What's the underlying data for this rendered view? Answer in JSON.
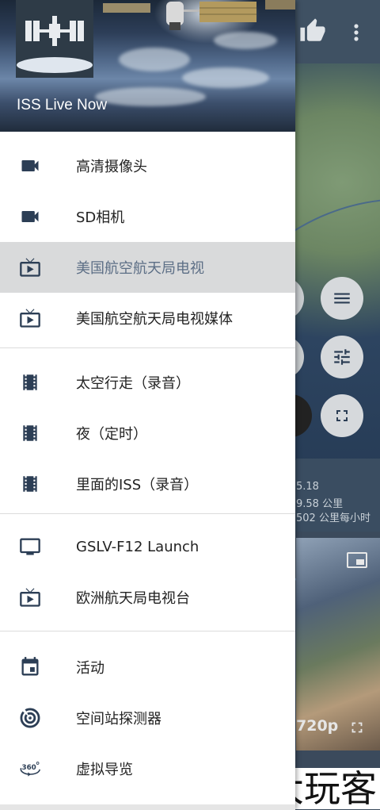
{
  "drawer": {
    "title": "ISS Live Now",
    "groups": [
      {
        "items": [
          {
            "icon": "video-camera-icon",
            "label": "高清摄像头",
            "selected": false
          },
          {
            "icon": "video-camera-icon",
            "label": "SD相机",
            "selected": false
          },
          {
            "icon": "live-tv-icon",
            "label": "美国航空航天局电视",
            "selected": true
          },
          {
            "icon": "live-tv-icon",
            "label": "美国航空航天局电视媒体",
            "selected": false
          }
        ]
      },
      {
        "items": [
          {
            "icon": "film-strip-icon",
            "label": "太空行走（录音）",
            "selected": false
          },
          {
            "icon": "film-strip-icon",
            "label": "夜（定时）",
            "selected": false
          },
          {
            "icon": "film-strip-icon",
            "label": "里面的ISS（录音）",
            "selected": false
          }
        ]
      },
      {
        "items": [
          {
            "icon": "monitor-icon",
            "label": "GSLV-F12 Launch",
            "selected": false
          },
          {
            "icon": "live-tv-icon",
            "label": "欧洲航天局电视台",
            "selected": false
          }
        ]
      },
      {
        "items": [
          {
            "icon": "calendar-event-icon",
            "label": "活动",
            "selected": false
          },
          {
            "icon": "radar-icon",
            "label": "空间站探测器",
            "selected": false
          },
          {
            "icon": "360-view-icon",
            "label": "虚拟导览",
            "selected": false
          }
        ]
      }
    ]
  },
  "background": {
    "info_lines": [
      "5.18",
      "9.58 公里",
      "502 公里每小时"
    ],
    "video_resolution": "720p"
  },
  "watermark": "大玩客",
  "colors": {
    "icon": "#2c3e55",
    "selected_bg": "#d9dadb",
    "selected_text": "#5d6f86"
  }
}
